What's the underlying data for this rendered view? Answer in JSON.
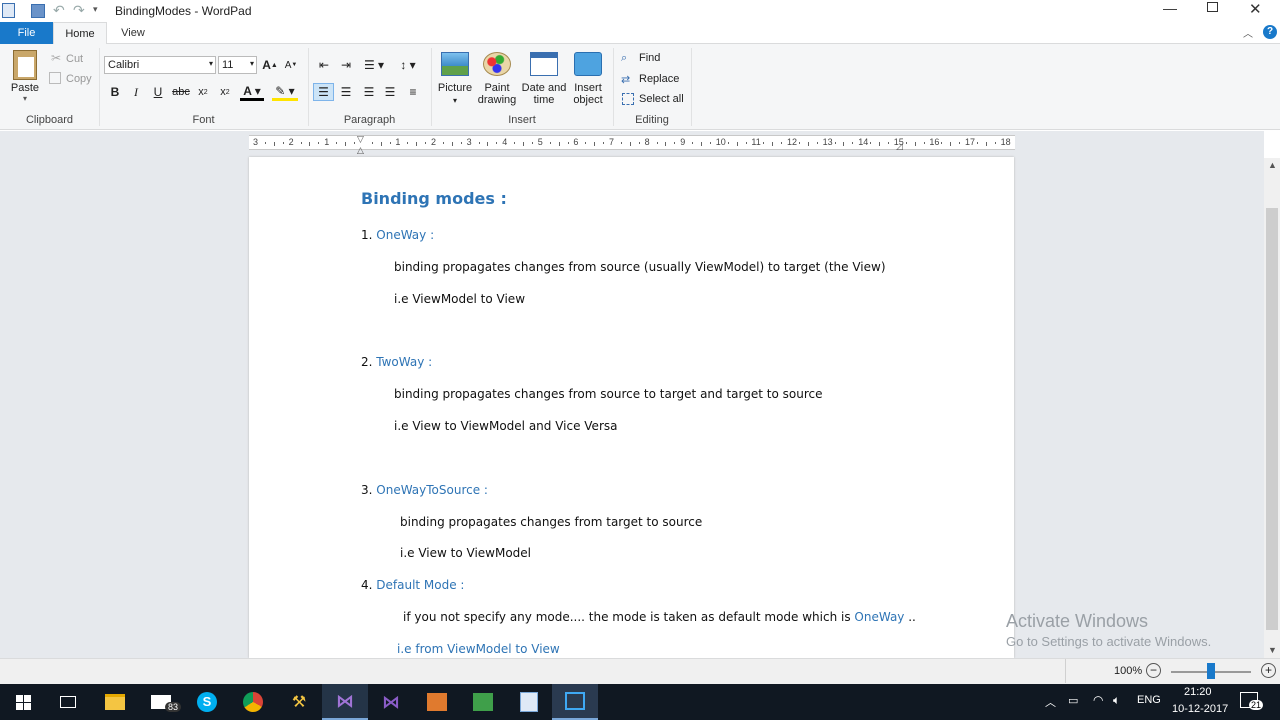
{
  "window": {
    "title": "BindingModes - WordPad"
  },
  "tabs": {
    "file": "File",
    "home": "Home",
    "view": "View"
  },
  "clipboard": {
    "paste": "Paste",
    "cut": "Cut",
    "copy": "Copy",
    "group": "Clipboard"
  },
  "font": {
    "family": "Calibri",
    "size": "11",
    "group": "Font"
  },
  "paragraph": {
    "group": "Paragraph"
  },
  "insert": {
    "picture": "Picture",
    "paint1": "Paint",
    "paint2": "drawing",
    "date1": "Date and",
    "date2": "time",
    "obj1": "Insert",
    "obj2": "object",
    "group": "Insert"
  },
  "editing": {
    "find": "Find",
    "replace": "Replace",
    "select_all": "Select all",
    "group": "Editing"
  },
  "ruler": {
    "labels": [
      "3",
      "2",
      "1",
      "",
      "1",
      "2",
      "3",
      "4",
      "5",
      "6",
      "7",
      "8",
      "9",
      "10",
      "11",
      "12",
      "13",
      "14",
      "15",
      "16",
      "17",
      "18"
    ]
  },
  "doc": {
    "heading": "Binding modes :",
    "l1n": "1. ",
    "l1": "OneWay :",
    "l2": "binding propagates changes from source (usually ViewModel) to target (the View)",
    "l3": "i.e ViewModel to View",
    "l4n": "2. ",
    "l4": "TwoWay :",
    "l5": "binding propagates changes from source to target and target to source",
    "l6": "i.e View to ViewModel and Vice Versa",
    "l7n": "3. ",
    "l7": "OneWayToSource :",
    "l8": "binding propagates changes from target to source",
    "l9": "i.e View to ViewModel",
    "l10n": "4. ",
    "l10": "Default Mode :",
    "l11a": "if you not specify any mode.... the mode is taken as default mode which is ",
    "l11b": "OneWay",
    "l11c": "  ..",
    "l12": "i.e from ViewModel to View"
  },
  "watermark": {
    "line1": "Activate Windows",
    "line2": "Go to Settings to activate Windows."
  },
  "status": {
    "zoom": "100%"
  },
  "taskbar": {
    "mail_badge": "83",
    "lang": "ENG",
    "time": "21:20",
    "date": "10-12-2017",
    "notif": "21"
  },
  "colors": {
    "accent": "#1979ca",
    "heading": "#2e74b5",
    "taskbar": "#101822"
  }
}
